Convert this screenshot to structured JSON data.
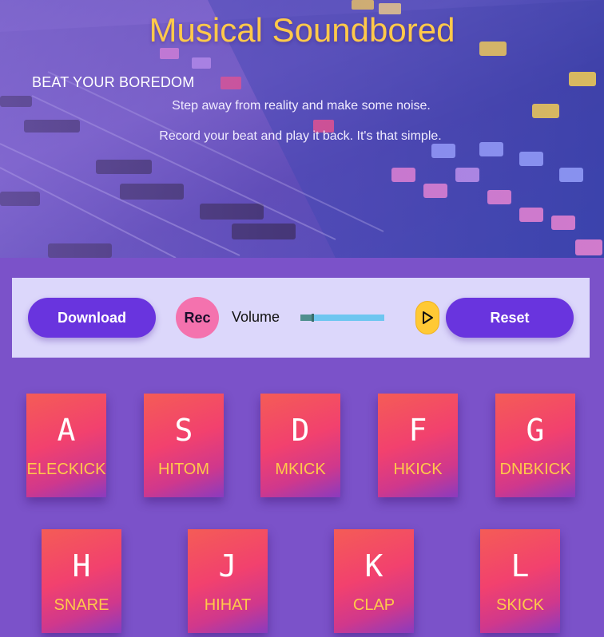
{
  "header": {
    "title": "Musical Soundbored",
    "subtitle": "BEAT YOUR BOREDOM",
    "tagline_1": "Step away from reality and make some noise.",
    "tagline_2": "Record your beat and play it back. It's that simple."
  },
  "controls": {
    "download_label": "Download",
    "rec_label": "Rec",
    "volume_label": "Volume",
    "volume_level": 0.15,
    "play_icon": "play-icon",
    "reset_label": "Reset"
  },
  "pads": [
    {
      "key": "A",
      "sound": "ELECKICK"
    },
    {
      "key": "S",
      "sound": "HITOM"
    },
    {
      "key": "D",
      "sound": "MKICK"
    },
    {
      "key": "F",
      "sound": "HKICK"
    },
    {
      "key": "G",
      "sound": "DNBKICK"
    },
    {
      "key": "H",
      "sound": "SNARE"
    },
    {
      "key": "J",
      "sound": "HIHAT"
    },
    {
      "key": "K",
      "sound": "CLAP"
    },
    {
      "key": "L",
      "sound": "SKICK"
    }
  ],
  "colors": {
    "background": "#7b52c9",
    "title": "#ffc94a",
    "button": "#6934de",
    "rec": "#f472ae",
    "play": "#ffc935",
    "panel": "#dcd7fb"
  }
}
